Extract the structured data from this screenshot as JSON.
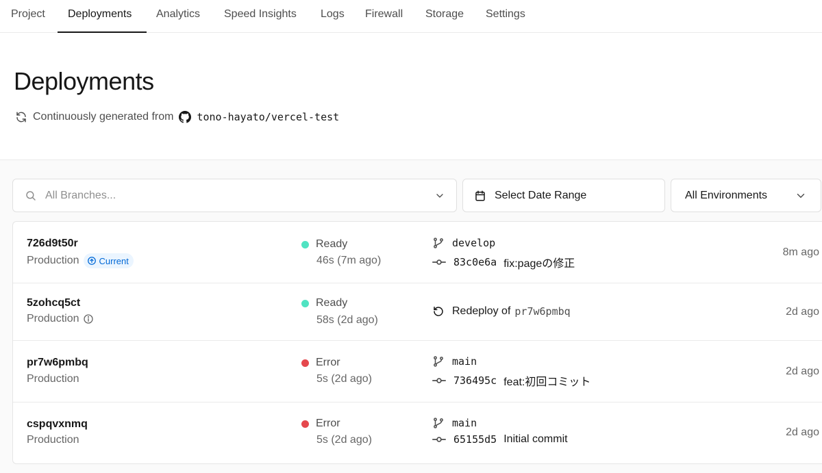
{
  "nav": {
    "tabs": [
      {
        "label": "Project"
      },
      {
        "label": "Deployments"
      },
      {
        "label": "Analytics"
      },
      {
        "label": "Speed Insights"
      },
      {
        "label": "Logs"
      },
      {
        "label": "Firewall"
      },
      {
        "label": "Storage"
      },
      {
        "label": "Settings"
      }
    ],
    "active": "Deployments"
  },
  "header": {
    "title": "Deployments",
    "source_prefix": "Continuously generated from",
    "repo": "tono-hayato/vercel-test"
  },
  "filters": {
    "branch_placeholder": "All Branches...",
    "date_label": "Select Date Range",
    "environment_label": "All Environments"
  },
  "colors": {
    "ready": "#50e3c2",
    "error": "#e5484d",
    "current_badge_bg": "#ebf5ff",
    "current_badge_text": "#0068d6"
  },
  "deployments": [
    {
      "id": "726d9t50r",
      "environment": "Production",
      "badge": "Current",
      "status": "Ready",
      "duration": "46s (7m ago)",
      "branch": "develop",
      "commit_sha": "83c0e6a",
      "commit_message": "fix:pageの修正",
      "age": "8m ago"
    },
    {
      "id": "5zohcq5ct",
      "environment": "Production",
      "status": "Ready",
      "duration": "58s (2d ago)",
      "redeploy_label": "Redeploy of",
      "redeploy_ref": "pr7w6pmbq",
      "age": "2d ago"
    },
    {
      "id": "pr7w6pmbq",
      "environment": "Production",
      "status": "Error",
      "duration": "5s (2d ago)",
      "branch": "main",
      "commit_sha": "736495c",
      "commit_message": "feat:初回コミット",
      "age": "2d ago"
    },
    {
      "id": "cspqvxnmq",
      "environment": "Production",
      "status": "Error",
      "duration": "5s (2d ago)",
      "branch": "main",
      "commit_sha": "65155d5",
      "commit_message": "Initial commit",
      "age": "2d ago"
    }
  ]
}
